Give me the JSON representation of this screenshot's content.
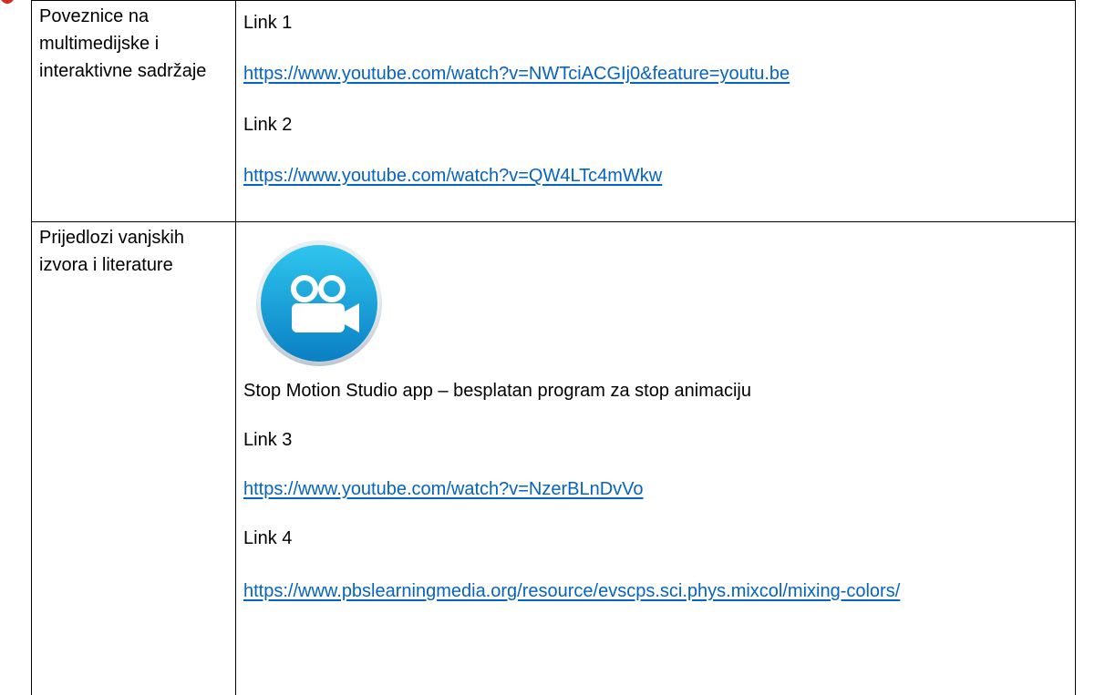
{
  "table": {
    "rows": [
      {
        "label": "Poveznice na multimedijske i interaktivne sadržaje",
        "items": [
          {
            "kind": "text",
            "text": "Link 1"
          },
          {
            "kind": "link",
            "text": "https://www.youtube.com/watch?v=NWTciACGIj0&feature=youtu.be"
          },
          {
            "kind": "text",
            "text": "Link 2"
          },
          {
            "kind": "link",
            "text": "https://www.youtube.com/watch?v=QW4LTc4mWkw"
          }
        ]
      },
      {
        "label": "Prijedlozi vanjskih izvora i literature",
        "app_icon": "video-camera-app-icon",
        "items": [
          {
            "kind": "text",
            "text": "Stop Motion Studio app – besplatan program za stop animaciju"
          },
          {
            "kind": "text",
            "text": "Link 3"
          },
          {
            "kind": "link",
            "text": "https://www.youtube.com/watch?v=NzerBLnDvVo"
          },
          {
            "kind": "text",
            "text": "Link 4"
          },
          {
            "kind": "link",
            "text": "https://www.pbslearningmedia.org/resource/evscps.sci.phys.mixcol/mixing-colors/"
          }
        ]
      }
    ]
  },
  "colors": {
    "link": "#0563c1",
    "border": "#000000",
    "icon_gradient_top": "#2fc6ee",
    "icon_gradient_bottom": "#0a7fc4",
    "accent": "#d62a2a"
  }
}
